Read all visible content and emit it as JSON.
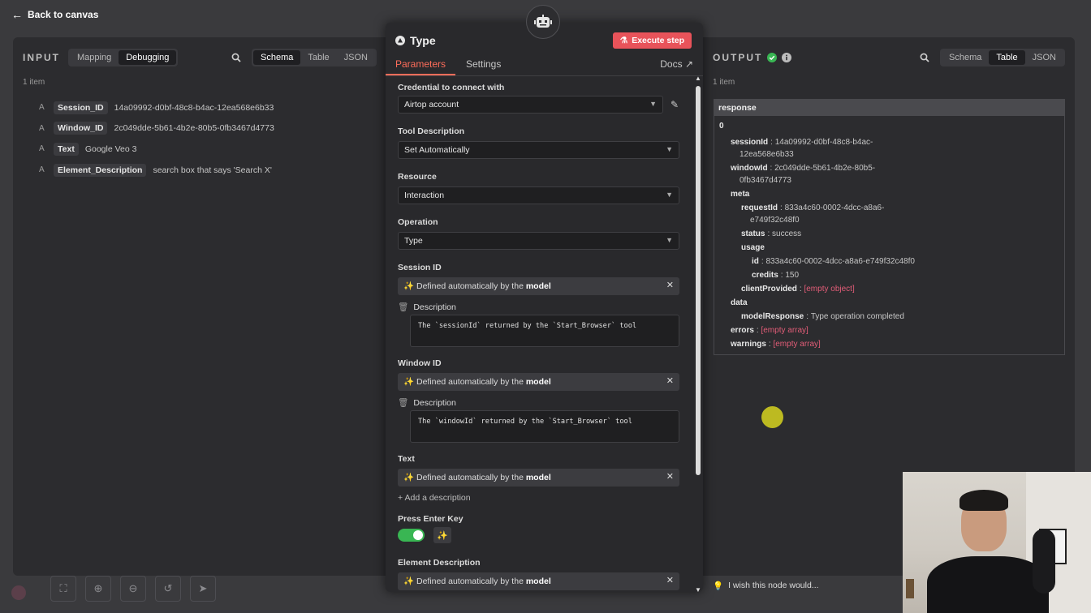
{
  "nav": {
    "back_label": "Back to canvas"
  },
  "input": {
    "title": "INPUT",
    "view_tabs": [
      "Mapping",
      "Debugging"
    ],
    "active_view_tab": "Debugging",
    "format_tabs": [
      "Schema",
      "Table",
      "JSON"
    ],
    "active_format_tab": "Schema",
    "item_count": "1 item",
    "fields": [
      {
        "type": "A",
        "key": "Session_ID",
        "value": "14a09992-d0bf-48c8-b4ac-12ea568e6b33"
      },
      {
        "type": "A",
        "key": "Window_ID",
        "value": "2c049dde-5b61-4b2e-80b5-0fb3467d4773"
      },
      {
        "type": "A",
        "key": "Text",
        "value": "Google Veo 3"
      },
      {
        "type": "A",
        "key": "Element_Description",
        "value": "search box that says 'Search X'"
      }
    ]
  },
  "node": {
    "title": "Type",
    "execute_label": "Execute step",
    "tabs": [
      "Parameters",
      "Settings"
    ],
    "active_tab": "Parameters",
    "docs_label": "Docs",
    "credential": {
      "label": "Credential to connect with",
      "value": "Airtop account"
    },
    "tool_description": {
      "label": "Tool Description",
      "value": "Set Automatically"
    },
    "resource": {
      "label": "Resource",
      "value": "Interaction"
    },
    "operation": {
      "label": "Operation",
      "value": "Type"
    },
    "auto_prefix": "Defined automatically by the",
    "auto_model": "model",
    "session_id": {
      "label": "Session ID",
      "description_label": "Description",
      "description": "The `sessionId` returned by the `Start_Browser` tool"
    },
    "window_id": {
      "label": "Window ID",
      "description_label": "Description",
      "description": "The `windowId` returned by the `Start_Browser` tool"
    },
    "text": {
      "label": "Text",
      "add_description": "+ Add a description"
    },
    "press_enter": {
      "label": "Press Enter Key",
      "enabled": true
    },
    "element_description": {
      "label": "Element Description"
    }
  },
  "output": {
    "title": "OUTPUT",
    "format_tabs": [
      "Schema",
      "Table",
      "JSON"
    ],
    "active_format_tab": "Table",
    "item_count": "1 item",
    "column_header": "response",
    "index": "0",
    "sessionId_key": "sessionId",
    "sessionId_val": "14a09992-d0bf-48c8-b4ac-",
    "sessionId_val2": "12ea568e6b33",
    "windowId_key": "windowId",
    "windowId_val": "2c049dde-5b61-4b2e-80b5-",
    "windowId_val2": "0fb3467d4773",
    "meta_key": "meta",
    "requestId_key": "requestId",
    "requestId_val": "833a4c60-0002-4dcc-a8a6-",
    "requestId_val2": "e749f32c48f0",
    "status_key": "status",
    "status_val": "success",
    "usage_key": "usage",
    "id_key": "id",
    "id_val": "833a4c60-0002-4dcc-a8a6-e749f32c48f0",
    "credits_key": "credits",
    "credits_val": "150",
    "clientProvided_key": "clientProvided",
    "clientProvided_val": "[empty object]",
    "data_key": "data",
    "modelResponse_key": "modelResponse",
    "modelResponse_val": "Type operation completed",
    "errors_key": "errors",
    "errors_val": "[empty array]",
    "warnings_key": "warnings",
    "warnings_val": "[empty array]"
  },
  "footer": {
    "wish_label": "I wish this node would..."
  },
  "colors": {
    "accent": "#ff6d5a",
    "execute": "#e8535a",
    "toggle_on": "#39b653",
    "success": "#39b653",
    "empty_value": "#e35d78"
  }
}
